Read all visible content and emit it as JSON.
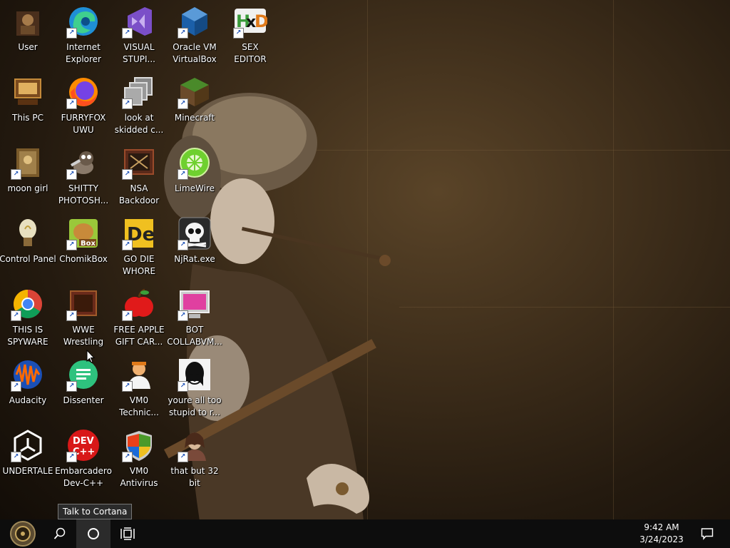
{
  "desktop": {
    "icons": [
      {
        "label": "User",
        "icon": "user-folder-icon"
      },
      {
        "label": "Internet\nExplorer",
        "icon": "edge-icon"
      },
      {
        "label": "VISUAL\nSTUPI...",
        "icon": "visual-studio-icon"
      },
      {
        "label": "Oracle VM\nVirtualBox",
        "icon": "virtualbox-icon"
      },
      {
        "label": "SEX\nEDITOR",
        "icon": "hxd-icon"
      },
      {
        "label": "This PC",
        "icon": "this-pc-icon"
      },
      {
        "label": "FURRYFOX\nUWU",
        "icon": "firefox-icon"
      },
      {
        "label": "look at\nskidded c...",
        "icon": "copy-windows-icon"
      },
      {
        "label": "Minecraft",
        "icon": "minecraft-icon"
      },
      {
        "label": "moon girl",
        "icon": "moon-girl-icon"
      },
      {
        "label": "SHITTY\nPHOTOSH...",
        "icon": "gimp-icon"
      },
      {
        "label": "NSA\nBackdoor",
        "icon": "nsa-backdoor-icon"
      },
      {
        "label": "LimeWire",
        "icon": "limewire-icon"
      },
      {
        "label": "Control Panel",
        "icon": "control-panel-icon"
      },
      {
        "label": "ChomikBox",
        "icon": "chomikbox-icon"
      },
      {
        "label": "GO DIE\nWHORE",
        "icon": "de-icon"
      },
      {
        "label": "NjRat.exe",
        "icon": "skull-icon"
      },
      {
        "label": "THIS IS\nSPYWARE",
        "icon": "chrome-icon"
      },
      {
        "label": "WWE\nWrestling",
        "icon": "wwe-icon"
      },
      {
        "label": "FREE APPLE\nGIFT CAR...",
        "icon": "apple-icon"
      },
      {
        "label": "BOT\nCOLLABVM...",
        "icon": "monitor-icon"
      },
      {
        "label": "Audacity",
        "icon": "audacity-icon"
      },
      {
        "label": "Dissenter",
        "icon": "dissenter-icon"
      },
      {
        "label": "VM0\nTechnic...",
        "icon": "technician-icon"
      },
      {
        "label": "youre all too\nstupid to r...",
        "icon": "face-portrait-icon"
      },
      {
        "label": "UNDERTALE",
        "icon": "unity-icon"
      },
      {
        "label": "Embarcadero\nDev-C++",
        "icon": "devcpp-icon"
      },
      {
        "label": "VM0\nAntivirus",
        "icon": "shield-icon"
      },
      {
        "label": "that but 32\nbit",
        "icon": "portrait-icon"
      }
    ]
  },
  "tooltip": {
    "text": "Talk to Cortana"
  },
  "taskbar": {
    "start": {
      "icon": "start-orb-icon"
    },
    "search": {
      "icon": "search-icon"
    },
    "cortana": {
      "icon": "cortana-circle-icon"
    },
    "taskview": {
      "icon": "task-view-icon"
    },
    "clock": {
      "time": "9:42 AM",
      "date": "3/24/2023"
    },
    "notifications": {
      "icon": "action-center-icon"
    }
  }
}
